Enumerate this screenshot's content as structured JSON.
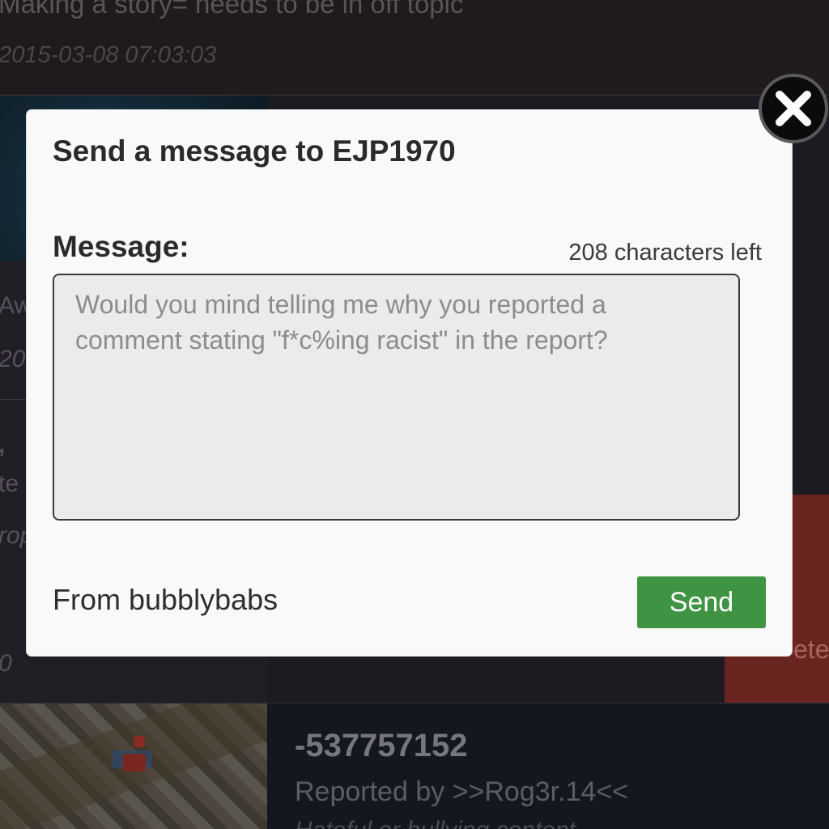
{
  "background": {
    "row1": {
      "title": "Making a story= needs to be in off topic",
      "date": "2015-03-08 07:03:03"
    },
    "fragments": {
      "aw": "Aw",
      "year": "20",
      "comma": ",",
      "te": "te",
      "rop": "rop",
      "zero": "0",
      "ete": "ete"
    },
    "row3": {
      "number": "-537757152",
      "reported_by": "Reported by >>Rog3r.14<<",
      "reason": "Hateful or bullying content"
    }
  },
  "modal": {
    "title": "Send a message to EJP1970",
    "message_label": "Message:",
    "chars_left": "208 characters left",
    "message_text": "Would you mind telling me why you reported a comment stating \"f*c%ing racist\" in the report?",
    "from": "From bubblybabs",
    "send_label": "Send",
    "close_icon": "close-icon"
  },
  "colors": {
    "send_button": "#3f9443",
    "modal_bg": "#f9f9f9",
    "textarea_bg": "#ebebeb",
    "close_button": "#0b0b0b"
  }
}
